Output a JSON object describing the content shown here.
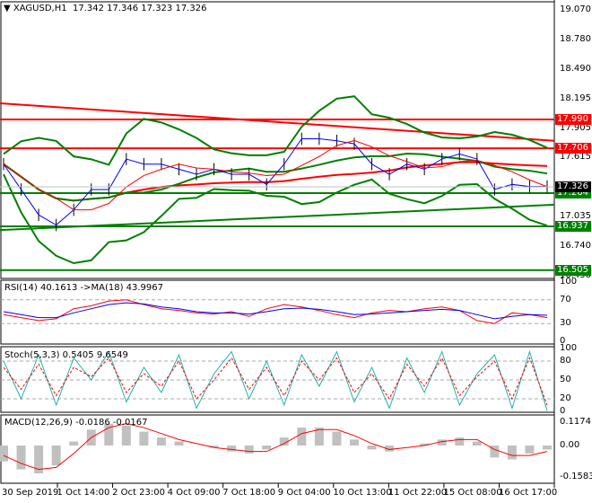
{
  "header": {
    "symbol": "XAGUSD,H1",
    "ohlc": "17.342 17.346 17.323 17.326"
  },
  "price_axis": [
    "19.070",
    "18.780",
    "18.490",
    "18.195",
    "17.905",
    "17.615",
    "17.035",
    "16.740",
    "16.450"
  ],
  "price_range": [
    16.45,
    19.07
  ],
  "levels": [
    {
      "value": 17.99,
      "label": "17.990",
      "color": "#ff0000"
    },
    {
      "value": 17.706,
      "label": "17.706",
      "color": "#ff0000"
    },
    {
      "value": 17.264,
      "label": "17.264",
      "color": "#008000"
    },
    {
      "value": 16.937,
      "label": "16.937",
      "color": "#008000"
    },
    {
      "value": 16.505,
      "label": "16.505",
      "color": "#008000"
    }
  ],
  "current_price": "17.326",
  "trendlines": [
    {
      "from": 18.15,
      "to": 17.78,
      "color": "#ff0000"
    },
    {
      "from": 16.9,
      "to": 17.15,
      "color": "#008000"
    }
  ],
  "close": [
    17.55,
    17.3,
    17.05,
    16.95,
    17.1,
    17.3,
    17.3,
    17.6,
    17.55,
    17.55,
    17.5,
    17.45,
    17.5,
    17.45,
    17.45,
    17.35,
    17.55,
    17.8,
    17.8,
    17.78,
    17.75,
    17.55,
    17.45,
    17.55,
    17.5,
    17.6,
    17.65,
    17.6,
    17.3,
    17.35,
    17.33,
    17.33
  ],
  "rsi": {
    "label": "RSI(14) 40.1613  ->MA(18) 43.9967",
    "axis": [
      "100",
      "70",
      "30",
      "0"
    ],
    "values": [
      45,
      40,
      35,
      38,
      55,
      60,
      68,
      70,
      62,
      55,
      52,
      48,
      46,
      50,
      42,
      55,
      62,
      58,
      52,
      45,
      40,
      48,
      52,
      50,
      55,
      58,
      52,
      35,
      30,
      48,
      45,
      40
    ],
    "ma": [
      50,
      45,
      40,
      40,
      48,
      55,
      62,
      65,
      63,
      58,
      55,
      50,
      48,
      48,
      46,
      50,
      55,
      56,
      54,
      50,
      45,
      46,
      48,
      50,
      52,
      54,
      52,
      45,
      38,
      42,
      45,
      44
    ]
  },
  "stoch": {
    "label": "Stoch(5,3,3) 0.5405 9.6549",
    "axis": [
      "100",
      "80",
      "50",
      "20",
      "0"
    ],
    "k": [
      80,
      20,
      90,
      10,
      85,
      50,
      95,
      15,
      70,
      30,
      90,
      5,
      60,
      95,
      20,
      80,
      10,
      90,
      40,
      95,
      15,
      70,
      5,
      85,
      30,
      95,
      10,
      60,
      90,
      5,
      95,
      1
    ],
    "d": [
      70,
      35,
      75,
      25,
      70,
      55,
      85,
      30,
      60,
      40,
      80,
      20,
      50,
      85,
      35,
      70,
      25,
      80,
      50,
      85,
      30,
      60,
      20,
      75,
      40,
      85,
      25,
      55,
      80,
      20,
      85,
      10
    ]
  },
  "macd": {
    "label": "MACD(12,26,9) -0.0186 -0.0167",
    "axis": [
      "0.1174",
      "0.00",
      "-0.1583"
    ],
    "hist": [
      -0.08,
      -0.12,
      -0.14,
      -0.1,
      0.02,
      0.08,
      0.11,
      0.1,
      0.07,
      0.04,
      0.02,
      0.0,
      -0.01,
      -0.03,
      -0.04,
      -0.02,
      0.04,
      0.09,
      0.09,
      0.07,
      0.03,
      -0.02,
      -0.03,
      0.0,
      0.01,
      0.03,
      0.04,
      0.02,
      -0.06,
      -0.07,
      -0.04,
      -0.02
    ],
    "signal": [
      -0.05,
      -0.09,
      -0.12,
      -0.11,
      -0.04,
      0.04,
      0.09,
      0.11,
      0.09,
      0.06,
      0.03,
      0.01,
      -0.01,
      -0.02,
      -0.03,
      -0.03,
      0.01,
      0.06,
      0.08,
      0.08,
      0.05,
      0.01,
      -0.02,
      -0.01,
      0.0,
      0.02,
      0.03,
      0.03,
      -0.02,
      -0.05,
      -0.05,
      -0.03
    ]
  },
  "time_axis": [
    "30 Sep 2019",
    "1 Oct 14:00",
    "2 Oct 23:00",
    "4 Oct 09:00",
    "7 Oct 18:00",
    "9 Oct 04:00",
    "10 Oct 13:00",
    "11 Oct 22:00",
    "15 Oct 08:00",
    "16 Oct 17:00"
  ]
}
